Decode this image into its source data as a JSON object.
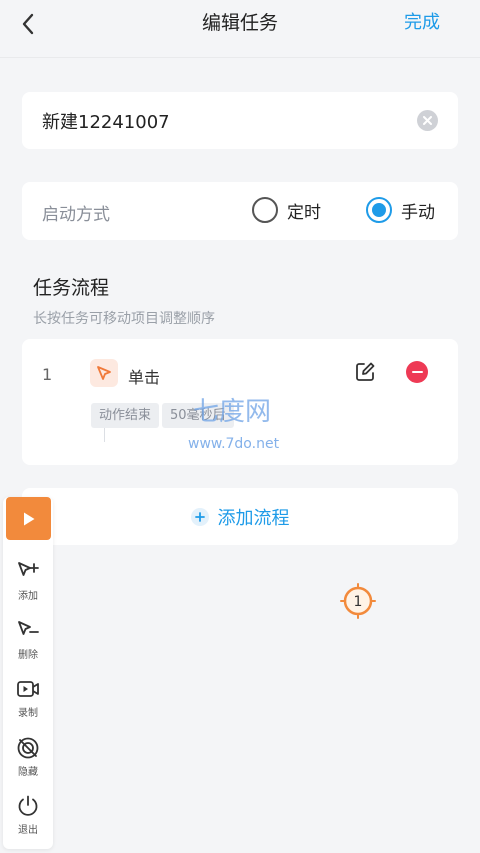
{
  "header": {
    "title": "编辑任务",
    "done_label": "完成"
  },
  "task_name": {
    "value": "新建12241007"
  },
  "launch_mode": {
    "label": "启动方式",
    "options": [
      "定时",
      "手动"
    ],
    "selected": "手动"
  },
  "flow_section": {
    "title": "任务流程",
    "hint": "长按任务可移动项目调整顺序"
  },
  "steps": [
    {
      "index": "1",
      "name": "单击",
      "tags": [
        "动作结束",
        "50毫秒后"
      ]
    }
  ],
  "add_flow": {
    "label": "添加流程"
  },
  "watermark": {
    "text": "七度网",
    "url": "www.7do.net"
  },
  "floating_toolbar": {
    "items": [
      {
        "label": "添加",
        "icon": "add-cursor-icon"
      },
      {
        "label": "删除",
        "icon": "remove-cursor-icon"
      },
      {
        "label": "录制",
        "icon": "record-icon"
      },
      {
        "label": "隐藏",
        "icon": "hide-icon"
      },
      {
        "label": "退出",
        "icon": "power-icon"
      }
    ]
  },
  "tap_marker": {
    "label": "1"
  },
  "colors": {
    "accent": "#1e9be8",
    "danger": "#ee3a55",
    "play": "#f28a3c",
    "background": "#f4f5f7"
  }
}
